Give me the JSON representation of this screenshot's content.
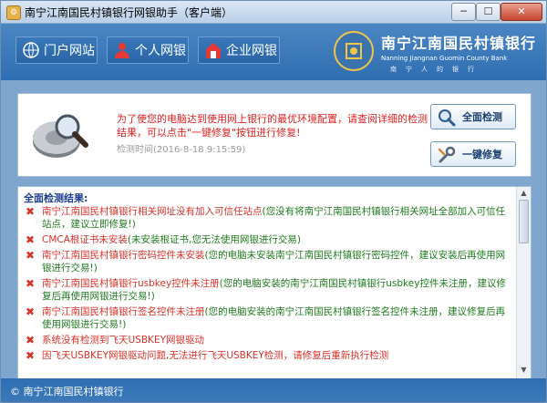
{
  "window": {
    "title": "南宁江南国民村镇银行网银助手（客户端）"
  },
  "titlebar_buttons": {
    "min": "─",
    "max": "☐",
    "close": "✕"
  },
  "nav": {
    "portal": "门户网站",
    "personal": "个人网银",
    "enterprise": "企业网银"
  },
  "logo": {
    "cn": "南宁江南国民村镇银行",
    "en": "Nanning  Jiangnan  Guomin  County  Bank",
    "sub": "南宁人的银行"
  },
  "notice": {
    "message": "为了使您的电脑达到使用网上银行的最优环境配置，请查阅详细的检测结果，可以点击\"一键修复\"按钮进行修复!",
    "time": "检测时间(2016-8-18 9:15:59)"
  },
  "buttons": {
    "scan": "全面检测",
    "fix": "一键修复"
  },
  "results": {
    "heading": "全面检测结果:",
    "items": [
      {
        "title": "南宁江南国民村镇银行相关网址没有加入可信任站点",
        "detail": "(您没有将南宁江南国民村镇银行相关网址全部加入可信任站点，建议立即修复!)"
      },
      {
        "title": "CMCA根证书未安装",
        "detail": "(未安装根证书,您无法使用网银进行交易)"
      },
      {
        "title": "南宁江南国民村镇银行密码控件未安装",
        "detail": "(您的电脑未安装南宁江南国民村镇银行密码控件，建议安装后再使用网银进行交易!)"
      },
      {
        "title": "南宁江南国民村镇银行usbkey控件未注册",
        "detail": "(您的电脑安装的南宁江南国民村镇银行usbkey控件未注册，建议修复后再使用网银进行交易!)"
      },
      {
        "title": "南宁江南国民村镇银行签名控件未注册",
        "detail": "(您的电脑安装的南宁江南国民村镇银行签名控件未注册，建议修复后再使用网银进行交易!)"
      },
      {
        "title": "系统没有检测到飞天USBKEY网银驱动",
        "detail": ""
      },
      {
        "title": "因飞天USBKEY网银驱动问题,无法进行飞天USBKEY检测，请修复后重新执行检测",
        "detail": ""
      }
    ]
  },
  "footer": {
    "copyright": "© 南宁江南国民村镇银行"
  },
  "colors": {
    "header": "#2f6eb2",
    "error": "#d8322a",
    "ok_text": "#1f7a1f",
    "warn": "#e02020"
  }
}
